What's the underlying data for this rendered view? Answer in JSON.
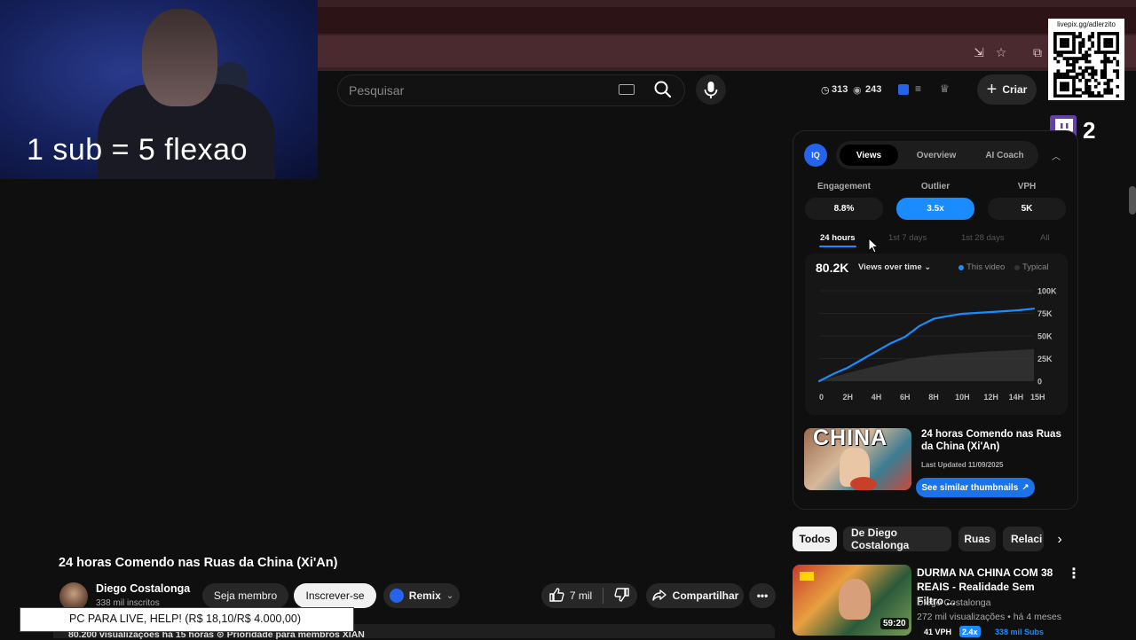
{
  "overlay": {
    "webcam_caption": "1 sub = 5 flexao",
    "qr_label": "livepix.gg/adlerzito",
    "twitch_count": "2",
    "donation_text": "PC PARA LIVE, HELP! (R$ 18,10/R$ 4.000,00)"
  },
  "header": {
    "search_placeholder": "Pesquisar",
    "stat_clock": "313",
    "stat_eye": "243",
    "create_label": "Criar"
  },
  "panel": {
    "logo": "IQ",
    "tabs": [
      {
        "label": "Views",
        "active": true
      },
      {
        "label": "Overview",
        "active": false
      },
      {
        "label": "AI Coach",
        "active": false
      }
    ],
    "metrics": [
      {
        "label": "Engagement",
        "value": "8.8%",
        "highlight": false
      },
      {
        "label": "Outlier",
        "value": "3.5x",
        "highlight": true
      },
      {
        "label": "VPH",
        "value": "5K",
        "highlight": false
      }
    ],
    "periods": [
      "24 hours",
      "1st 7 days",
      "1st 28 days",
      "All"
    ],
    "total_views": "80.2K",
    "chart_mode": "Views over time",
    "legend_this": "This video",
    "legend_typical": "Typical",
    "accent_color": "#1a8cff",
    "related": {
      "thumb_word": "CHINA",
      "title": "24 horas Comendo nas Ruas da China (Xi'An)",
      "updated": "Last Updated 11/09/2025",
      "similar_label": "See similar thumbnails"
    }
  },
  "chart_data": {
    "type": "line",
    "x_ticks": [
      "0",
      "2H",
      "4H",
      "6H",
      "8H",
      "10H",
      "12H",
      "14H",
      "15H"
    ],
    "y_ticks": [
      "100K",
      "75K",
      "50K",
      "25K",
      "0"
    ],
    "ylim": [
      0,
      100000
    ],
    "xlim": [
      0,
      15
    ],
    "series": [
      {
        "name": "This video",
        "color": "#1a8cff",
        "x": [
          0,
          0.5,
          1,
          2,
          3,
          4,
          5,
          6,
          6.5,
          7,
          7.5,
          8,
          9,
          10,
          11,
          12,
          13,
          14,
          15
        ],
        "y": [
          0,
          4000,
          8000,
          15000,
          24000,
          33000,
          42000,
          49000,
          55000,
          61000,
          65000,
          69000,
          72000,
          74500,
          75500,
          76500,
          77500,
          78500,
          80200
        ]
      },
      {
        "name": "Typical",
        "color": "#3a3a3a",
        "fill": true,
        "x": [
          0,
          2,
          4,
          6,
          8,
          10,
          12,
          14,
          15
        ],
        "y": [
          0,
          9000,
          17000,
          24000,
          28500,
          31000,
          33000,
          34500,
          35500
        ]
      }
    ]
  },
  "chips": [
    {
      "label": "Todos",
      "active": true
    },
    {
      "label": "De Diego Costalonga",
      "active": false
    },
    {
      "label": "Ruas",
      "active": false
    },
    {
      "label": "Relaci",
      "active": false
    }
  ],
  "recommended": {
    "title": "DURMA NA CHINA COM 38 REAIS - Realidade Sem Filtro ...",
    "channel": "Diego Costalonga",
    "meta": "272 mil visualizações • há 4 meses",
    "duration": "59:20",
    "badge_vph": "41 VPH",
    "badge_outlier": "2.4x",
    "badge_subs": "338 mil Subs"
  },
  "video": {
    "title": "24 horas Comendo nas Ruas da China (Xi'An)",
    "channel_name": "Diego Costalonga",
    "channel_subs": "338 mil inscritos",
    "member_label": "Seja membro",
    "subscribe_label": "Inscrever-se",
    "remix_label": "Remix",
    "likes": "7 mil",
    "share_label": "Compartilhar",
    "description_line": "80.200 visualizações  há 15 horas  ⊙ Prioridade para membros  XIAN"
  }
}
